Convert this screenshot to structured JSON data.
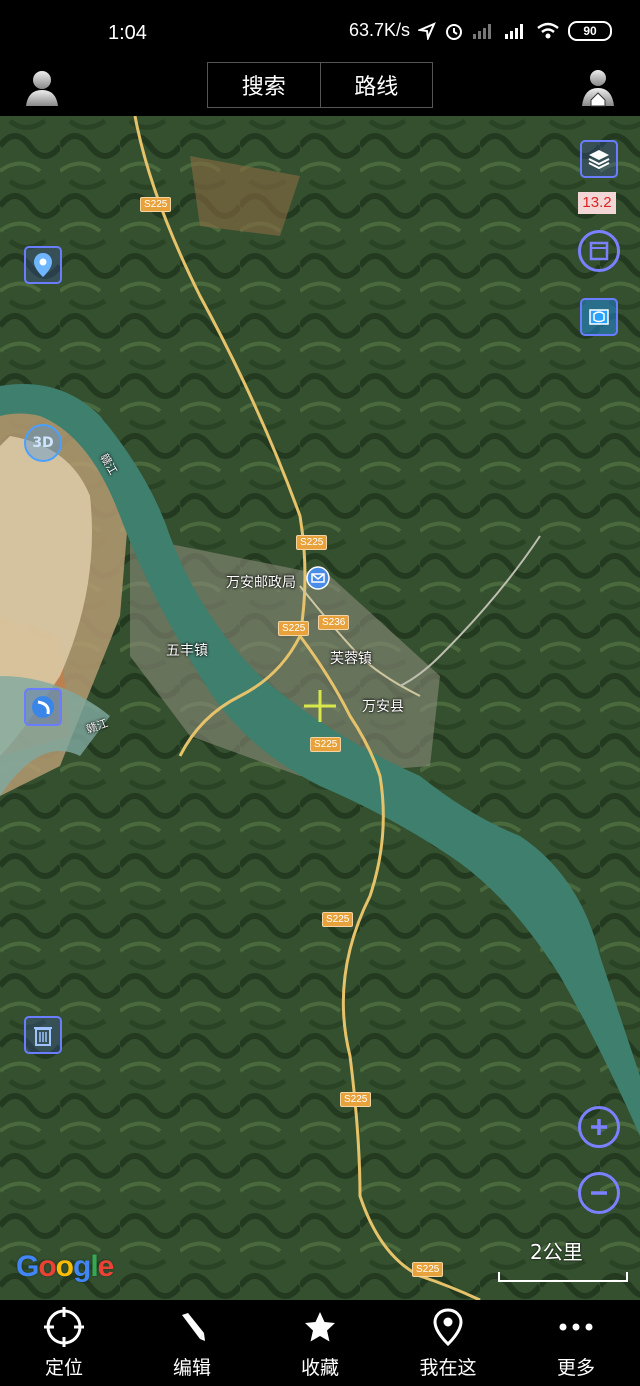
{
  "status_bar": {
    "time": "1:04",
    "net_speed": "63.7K/s",
    "battery": "90"
  },
  "top_bar": {
    "search_label": "搜索",
    "route_label": "路线"
  },
  "map": {
    "zoom_level": "13.2",
    "three_d_label": "3D",
    "labels": {
      "post_office": "万安邮政局",
      "wufeng": "五丰镇",
      "furong": "芙蓉镇",
      "wanan": "万安县",
      "gan_river": "赣江"
    },
    "roads": {
      "s225": "S225",
      "s236": "S236"
    },
    "scale": "2公里",
    "attribution": "Google"
  },
  "bottom_nav": [
    {
      "label": "定位",
      "icon": "crosshair-icon"
    },
    {
      "label": "编辑",
      "icon": "pencil-icon"
    },
    {
      "label": "收藏",
      "icon": "star-icon"
    },
    {
      "label": "我在这",
      "icon": "pin-icon"
    },
    {
      "label": "更多",
      "icon": "more-icon"
    }
  ]
}
